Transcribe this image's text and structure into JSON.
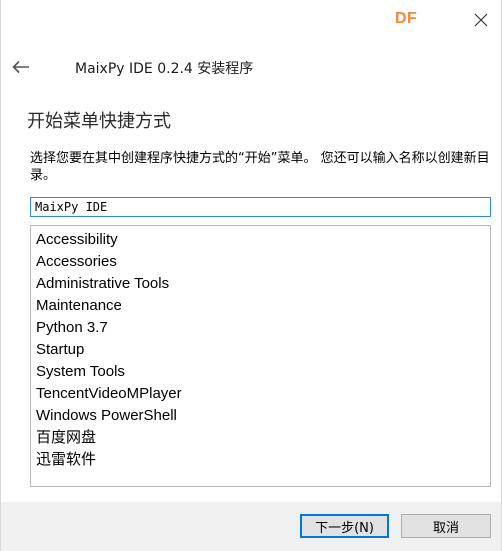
{
  "titlebar": {
    "logo_text": "DF",
    "logo_color": "#f08a3c",
    "close_icon": "close-icon",
    "back_icon": "arrow-left-icon"
  },
  "app_title": "MaixPy IDE 0.2.4 安装程序",
  "page": {
    "heading": "开始菜单快捷方式",
    "description": "选择您要在其中创建程序快捷方式的“开始”菜单。 您还可以输入名称以创建新目录。"
  },
  "folder_input": {
    "value": "MaixPy IDE"
  },
  "folder_list": {
    "items": [
      "Accessibility",
      "Accessories",
      "Administrative Tools",
      "Maintenance",
      "Python 3.7",
      "Startup",
      "System Tools",
      "TencentVideoMPlayer",
      "Windows PowerShell",
      "百度网盘",
      "迅雷软件"
    ]
  },
  "footer": {
    "next_label": "下一步(N)",
    "cancel_label": "取消"
  },
  "colors": {
    "accent": "#0078d7",
    "input_border": "#2c8fd6",
    "footer_bg": "#f0f0f0"
  }
}
